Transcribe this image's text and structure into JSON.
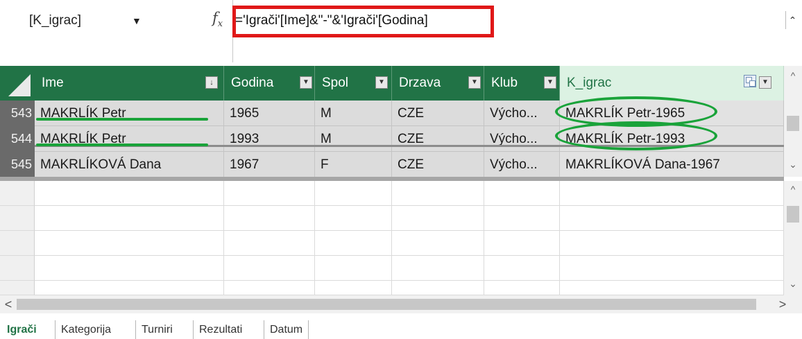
{
  "formula_bar": {
    "name_box": "[K_igrac]",
    "fx": "f",
    "fx_sub": "x",
    "formula": "='Igrači'[Ime]&\"-\"&'Igrači'[Godina]"
  },
  "columns": [
    {
      "label": "Ime"
    },
    {
      "label": "Godina"
    },
    {
      "label": "Spol"
    },
    {
      "label": "Drzava"
    },
    {
      "label": "Klub"
    },
    {
      "label": "K_igrac"
    }
  ],
  "rows": [
    {
      "num": "543",
      "cells": [
        "MAKRLÍK Petr",
        "1965",
        "M",
        "CZE",
        "Výcho...",
        "MAKRLÍK Petr-1965"
      ]
    },
    {
      "num": "544",
      "cells": [
        "MAKRLÍK Petr",
        "1993",
        "M",
        "CZE",
        "Výcho...",
        "MAKRLÍK Petr-1993"
      ]
    },
    {
      "num": "545",
      "cells": [
        "MAKRLÍKOVÁ Dana",
        "1967",
        "F",
        "CZE",
        "Výcho...",
        "MAKRLÍKOVÁ Dana-1967"
      ]
    }
  ],
  "sheet_tabs": [
    {
      "label": "Igrači",
      "active": true
    },
    {
      "label": "Kategorija",
      "active": false
    },
    {
      "label": "Turniri",
      "active": false
    },
    {
      "label": "Rezultati",
      "active": false
    },
    {
      "label": "Datum",
      "active": false
    }
  ],
  "colors": {
    "header_green": "#217346",
    "active_header": "#dcf2e3",
    "highlight_red": "#e01818",
    "annotation_green": "#1aa33a"
  },
  "icons": {
    "fx": "function-icon",
    "dropdown": "chevron-down-icon",
    "collapse": "double-chevron-up-icon",
    "filter": "filter-dropdown-icon",
    "sort": "sort-icon",
    "format": "column-format-icon"
  }
}
